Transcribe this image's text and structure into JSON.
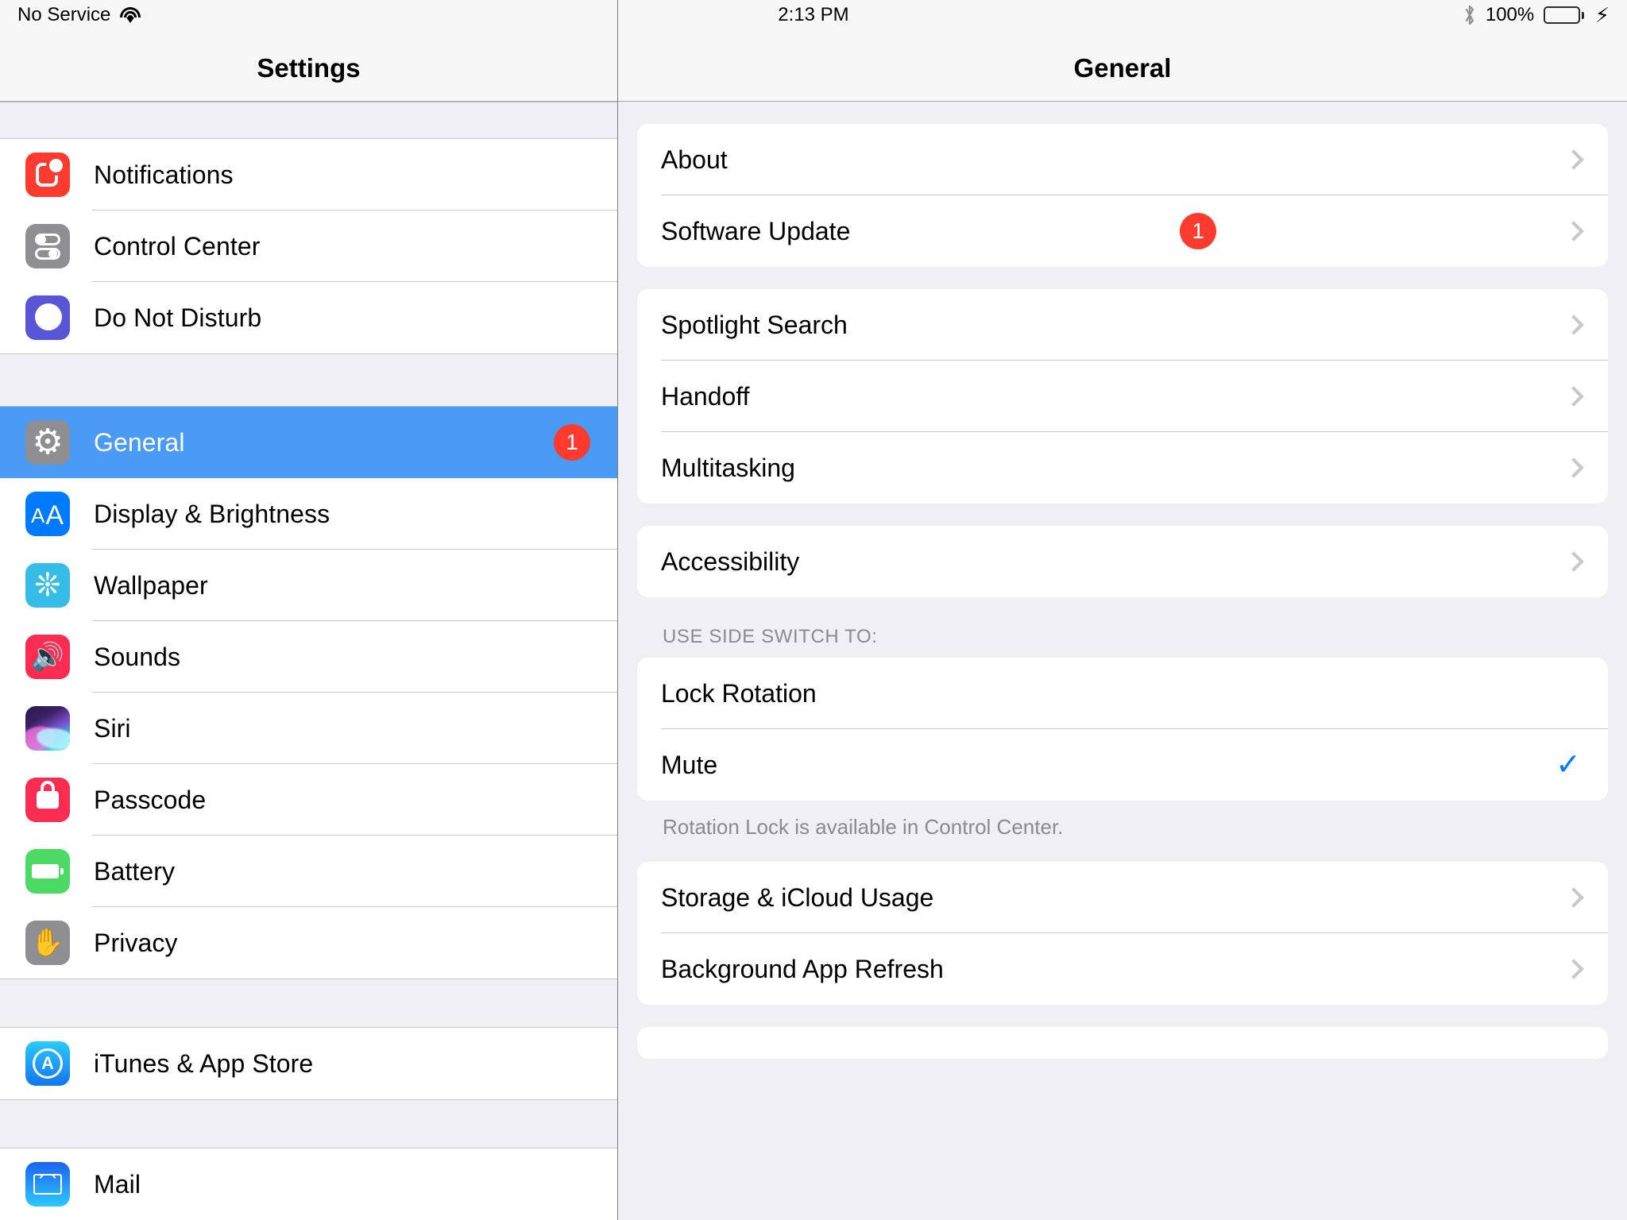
{
  "status_bar": {
    "carrier": "No Service",
    "wifi_icon": "wifi-icon",
    "time": "2:13 PM",
    "bluetooth_icon": "bluetooth-icon",
    "battery_percent": "100%",
    "battery_level": 100,
    "charging_icon": "lightning-bolt-icon",
    "battery_color": "#4CD964"
  },
  "sidebar": {
    "title": "Settings",
    "groups": [
      {
        "items": [
          {
            "label": "Notifications",
            "icon": "notifications-icon",
            "selected": false,
            "badge": null
          },
          {
            "label": "Control Center",
            "icon": "control-center-icon",
            "selected": false,
            "badge": null
          },
          {
            "label": "Do Not Disturb",
            "icon": "do-not-disturb-icon",
            "selected": false,
            "badge": null
          }
        ]
      },
      {
        "items": [
          {
            "label": "General",
            "icon": "gear-icon",
            "selected": true,
            "badge": "1"
          },
          {
            "label": "Display & Brightness",
            "icon": "display-icon",
            "selected": false,
            "badge": null
          },
          {
            "label": "Wallpaper",
            "icon": "wallpaper-icon",
            "selected": false,
            "badge": null
          },
          {
            "label": "Sounds",
            "icon": "sounds-icon",
            "selected": false,
            "badge": null
          },
          {
            "label": "Siri",
            "icon": "siri-icon",
            "selected": false,
            "badge": null
          },
          {
            "label": "Passcode",
            "icon": "passcode-icon",
            "selected": false,
            "badge": null
          },
          {
            "label": "Battery",
            "icon": "battery-icon",
            "selected": false,
            "badge": null
          },
          {
            "label": "Privacy",
            "icon": "privacy-icon",
            "selected": false,
            "badge": null
          }
        ]
      },
      {
        "items": [
          {
            "label": "iTunes & App Store",
            "icon": "app-store-icon",
            "selected": false,
            "badge": null
          }
        ]
      },
      {
        "items": [
          {
            "label": "Mail",
            "icon": "mail-icon",
            "selected": false,
            "badge": null
          }
        ]
      }
    ]
  },
  "detail": {
    "title": "General",
    "sections": [
      {
        "header": null,
        "footer": null,
        "rows": [
          {
            "label": "About",
            "chevron": true,
            "badge": null,
            "checked": false
          },
          {
            "label": "Software Update",
            "chevron": true,
            "badge": "1",
            "checked": false
          }
        ]
      },
      {
        "header": null,
        "footer": null,
        "rows": [
          {
            "label": "Spotlight Search",
            "chevron": true,
            "badge": null,
            "checked": false
          },
          {
            "label": "Handoff",
            "chevron": true,
            "badge": null,
            "checked": false
          },
          {
            "label": "Multitasking",
            "chevron": true,
            "badge": null,
            "checked": false
          }
        ]
      },
      {
        "header": null,
        "footer": null,
        "rows": [
          {
            "label": "Accessibility",
            "chevron": true,
            "badge": null,
            "checked": false
          }
        ]
      },
      {
        "header": "USE SIDE SWITCH TO:",
        "footer": "Rotation Lock is available in Control Center.",
        "rows": [
          {
            "label": "Lock Rotation",
            "chevron": false,
            "badge": null,
            "checked": false
          },
          {
            "label": "Mute",
            "chevron": false,
            "badge": null,
            "checked": true
          }
        ]
      },
      {
        "header": null,
        "footer": null,
        "rows": [
          {
            "label": "Storage & iCloud Usage",
            "chevron": true,
            "badge": null,
            "checked": false
          },
          {
            "label": "Background App Refresh",
            "chevron": true,
            "badge": null,
            "checked": false
          }
        ]
      }
    ]
  },
  "colors": {
    "selection_blue": "#4A9BF5",
    "badge_red": "#FF3B30",
    "accent_blue": "#007AFF",
    "background": "#EFEFF4"
  }
}
